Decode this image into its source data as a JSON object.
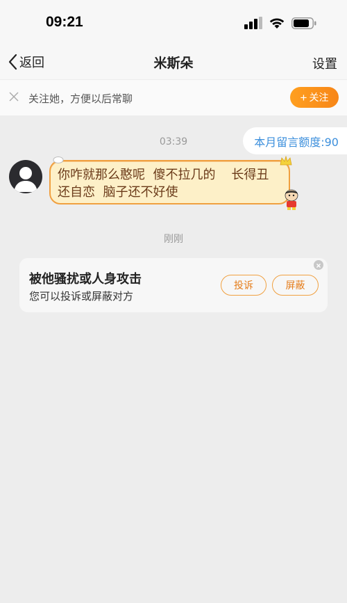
{
  "status_bar": {
    "time": "09:21"
  },
  "nav": {
    "back_label": "返回",
    "title": "米斯朵",
    "settings_label": "设置"
  },
  "follow_banner": {
    "text": "关注她，方便以后常聊",
    "follow_button": "关注"
  },
  "chat": {
    "quota": "本月留言额度:90",
    "timestamp_1": "03:39",
    "message_line_1": "你咋就那么憨呢  傻不拉几的    长得丑",
    "message_line_2": "还自恋  脑子还不好使",
    "timestamp_2": "刚刚"
  },
  "report_card": {
    "title": "被他骚扰或人身攻击",
    "subtitle": "您可以投诉或屏蔽对方",
    "complain_button": "投诉",
    "block_button": "屏蔽"
  },
  "colors": {
    "accent_orange": "#f7941d",
    "quota_blue": "#3c8fdc",
    "bubble_fill": "#fdf0c8"
  }
}
